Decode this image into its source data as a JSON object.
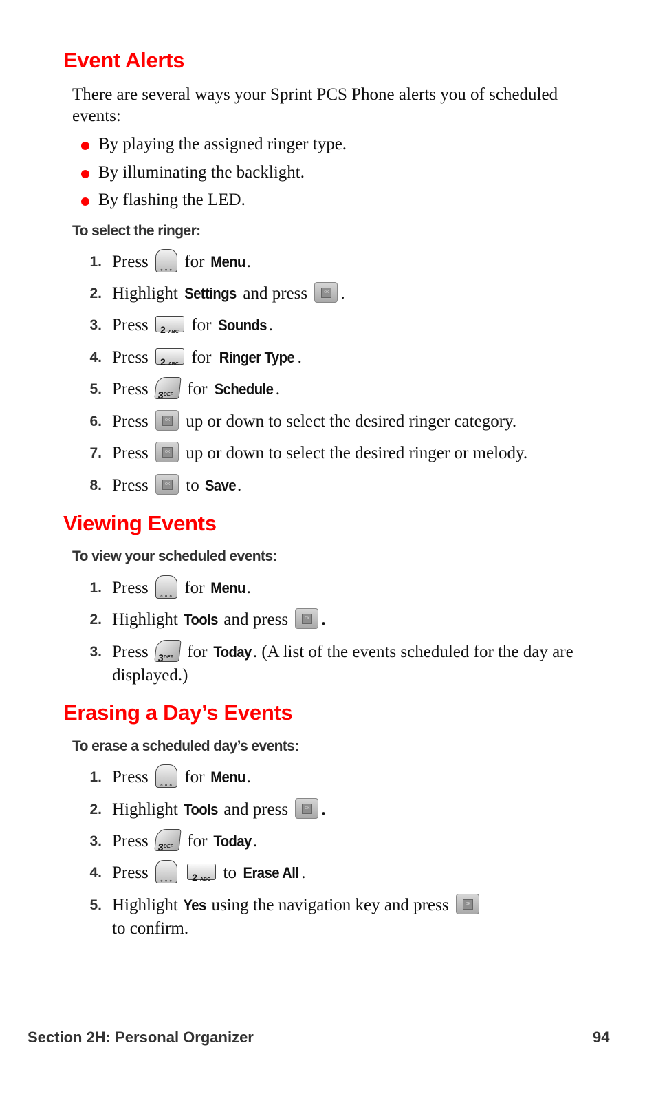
{
  "sections": {
    "event_alerts": {
      "title": "Event Alerts",
      "intro": "There are several ways your Sprint PCS Phone alerts you of scheduled events:",
      "bullets": [
        "By playing the assigned ringer type.",
        "By illuminating the backlight.",
        "By flashing the LED."
      ],
      "subheading": "To select the ringer:",
      "steps": [
        {
          "num": "1.",
          "pre": "Press",
          "keys": [
            "menu-key"
          ],
          "mid": "for",
          "kw": "Menu",
          "post": "."
        },
        {
          "num": "2.",
          "pre": "Highlight",
          "kw": "Settings",
          "mid": "and press",
          "keys": [
            "ok-key"
          ],
          "post": "."
        },
        {
          "num": "3.",
          "pre": "Press",
          "keys": [
            "2-abc-key"
          ],
          "mid": "for",
          "kw": "Sounds",
          "post": "."
        },
        {
          "num": "4.",
          "pre": "Press",
          "keys": [
            "2-abc-key"
          ],
          "mid": "for",
          "kw": "Ringer Type",
          "post": "."
        },
        {
          "num": "5.",
          "pre": "Press",
          "keys": [
            "3-def-key"
          ],
          "mid": "for",
          "kw": "Schedule",
          "post": "."
        },
        {
          "num": "6.",
          "pre": "Press",
          "keys": [
            "ok-key"
          ],
          "mid": "up or down to select the desired ringer category.",
          "kw": "",
          "post": ""
        },
        {
          "num": "7.",
          "pre": "Press",
          "keys": [
            "ok-key"
          ],
          "mid": "up or down to select the desired ringer or melody.",
          "kw": "",
          "post": ""
        },
        {
          "num": "8.",
          "pre": "Press",
          "keys": [
            "ok-key"
          ],
          "mid": "to",
          "kw": "Save",
          "post": "."
        }
      ]
    },
    "viewing_events": {
      "title": "Viewing Events",
      "subheading": "To view your scheduled events:",
      "steps": [
        {
          "num": "1.",
          "pre": "Press",
          "mid": "for",
          "kw": "Menu",
          "post": "."
        },
        {
          "num": "2.",
          "pre": "Highlight",
          "kw": "Tools",
          "mid": "and press",
          "post": "."
        },
        {
          "num": "3.",
          "pre": "Press",
          "mid": "for",
          "kw": "Today",
          "post": ". (A list of the events scheduled for the day are displayed.)"
        }
      ]
    },
    "erasing_events": {
      "title": "Erasing a Day’s Events",
      "subheading": "To erase a scheduled day’s events:",
      "steps": [
        {
          "num": "1.",
          "pre": "Press",
          "mid": "for",
          "kw": "Menu",
          "post": "."
        },
        {
          "num": "2.",
          "pre": "Highlight",
          "kw": "Tools",
          "mid": "and press",
          "post": "."
        },
        {
          "num": "3.",
          "pre": "Press",
          "mid": "for",
          "kw": "Today",
          "post": "."
        },
        {
          "num": "4.",
          "pre": "Press",
          "mid": "to",
          "kw": "Erase All",
          "post": "."
        },
        {
          "num": "5.",
          "pre": "Highlight",
          "kw": "Yes",
          "mid": "using the navigation key and press",
          "post": "to confirm."
        }
      ]
    }
  },
  "keys": {
    "menu": "∘∘∘",
    "ok": "OK",
    "two_digit": "2",
    "two_letters": "ABC",
    "three_digit": "3",
    "three_letters": "DEF"
  },
  "footer": {
    "section": "Section 2H: Personal Organizer",
    "page_number": "94"
  }
}
